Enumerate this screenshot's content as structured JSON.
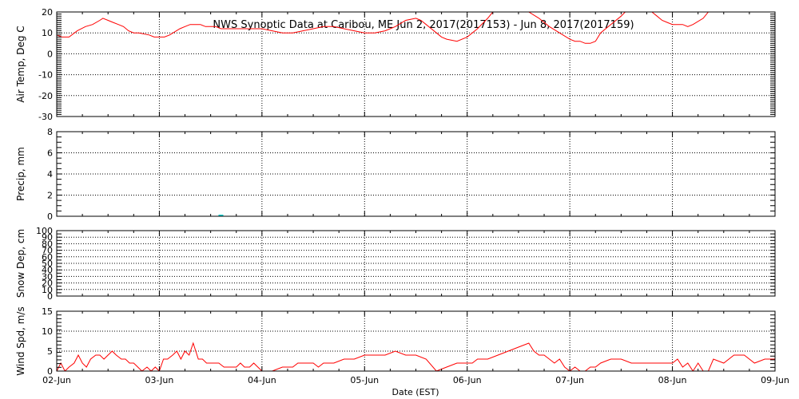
{
  "chart_data": {
    "title": "NWS Synoptic Data at Caribou, ME   Jun  2, 2017(2017153) - Jun  8, 2017(2017159)",
    "xlabel": "Date (EST)",
    "x_ticks": [
      "02-Jun",
      "03-Jun",
      "04-Jun",
      "05-Jun",
      "06-Jun",
      "07-Jun",
      "08-Jun",
      "09-Jun"
    ],
    "x_range_days": [
      0,
      7
    ],
    "colors": {
      "temp": "#ff0000",
      "precip": "#00cccc",
      "snow": "#ff0000",
      "wind": "#ff0000",
      "grid": "#000000"
    },
    "panels": [
      {
        "name": "air-temp",
        "type": "line",
        "ylabel": "Air Temp, Deg C",
        "ylim": [
          -30,
          20
        ],
        "yticks": [
          -30,
          -20,
          -10,
          0,
          10,
          20
        ],
        "ytick_labels": [
          "-30",
          "-20",
          "-10",
          "0",
          "10",
          "20"
        ],
        "grid": true,
        "series": [
          {
            "x": [
              0,
              0.05,
              0.12,
              0.2,
              0.28,
              0.35,
              0.42,
              0.45,
              0.5,
              0.55,
              0.6,
              0.65,
              0.7,
              0.75,
              0.8,
              0.9,
              0.95,
              1.0,
              1.05,
              1.1,
              1.2,
              1.25,
              1.3,
              1.35,
              1.4,
              1.45,
              1.5,
              1.55,
              1.6,
              1.65,
              1.7,
              1.8,
              1.9,
              2.0,
              2.1,
              2.2,
              2.3,
              2.4,
              2.5,
              2.6,
              2.7,
              2.8,
              2.9,
              3.0,
              3.1,
              3.2,
              3.3,
              3.4,
              3.5,
              3.55,
              3.6,
              3.65,
              3.7,
              3.75,
              3.8,
              3.9,
              4.0,
              4.1,
              4.2,
              4.25,
              4.3,
              4.4,
              4.5,
              4.6,
              4.7,
              4.8,
              4.9,
              5.0,
              5.05,
              5.1,
              5.15,
              5.2,
              5.25,
              5.3,
              5.4,
              5.5,
              5.6,
              5.7,
              5.8,
              5.85,
              5.9,
              5.95,
              6.0,
              6.1,
              6.15,
              6.2,
              6.3,
              6.35,
              6.4,
              6.45,
              6.5
            ],
            "y": [
              9,
              8,
              8,
              11,
              13,
              14,
              16,
              17,
              16,
              15,
              14,
              13,
              11,
              10,
              10,
              9,
              8,
              8,
              8,
              9,
              12,
              13,
              14,
              14,
              14,
              13,
              13,
              13,
              12,
              12,
              12,
              12,
              12,
              12,
              11,
              10,
              10,
              11,
              12,
              13,
              13,
              12,
              11,
              10,
              10,
              11,
              13,
              16,
              17,
              16,
              14,
              12,
              10,
              8,
              7,
              6,
              8,
              12,
              17,
              20,
              22,
              23,
              22,
              20,
              17,
              13,
              10,
              7,
              6,
              6,
              5,
              5,
              6,
              10,
              14,
              18,
              23,
              22,
              20,
              18,
              16,
              15,
              14,
              14,
              13,
              14,
              17,
              20,
              24,
              28,
              30
            ]
          }
        ]
      },
      {
        "name": "precip",
        "type": "bar",
        "ylabel": "Precip, mm",
        "ylim": [
          0,
          8
        ],
        "yticks": [
          0,
          2,
          4,
          6,
          8
        ],
        "ytick_labels": [
          "0",
          "2",
          "4",
          "6",
          "8"
        ],
        "grid": true,
        "series": [
          {
            "x": [
              1.6
            ],
            "y": [
              0.1
            ]
          }
        ]
      },
      {
        "name": "snow-depth",
        "type": "line",
        "ylabel": "Snow Dep, cm",
        "ylim": [
          0,
          100
        ],
        "yticks": [
          0,
          10,
          20,
          30,
          40,
          50,
          60,
          70,
          80,
          90,
          100
        ],
        "ytick_labels": [
          "0",
          "10",
          "20",
          "30",
          "40",
          "50",
          "60",
          "70",
          "80",
          "90",
          "100"
        ],
        "grid": true,
        "series": []
      },
      {
        "name": "wind-speed",
        "type": "line",
        "ylabel": "Wind Spd, m/s",
        "ylim": [
          0,
          15
        ],
        "yticks": [
          0,
          5,
          10,
          15
        ],
        "ytick_labels": [
          "0",
          "5",
          "10",
          "15"
        ],
        "grid": true,
        "series": [
          {
            "x": [
              0,
              0.04,
              0.08,
              0.12,
              0.17,
              0.21,
              0.25,
              0.29,
              0.33,
              0.38,
              0.42,
              0.46,
              0.5,
              0.54,
              0.58,
              0.63,
              0.67,
              0.71,
              0.75,
              0.79,
              0.83,
              0.88,
              0.92,
              0.96,
              1.0,
              1.04,
              1.08,
              1.13,
              1.17,
              1.21,
              1.25,
              1.29,
              1.33,
              1.38,
              1.42,
              1.46,
              1.5,
              1.54,
              1.58,
              1.63,
              1.67,
              1.71,
              1.75,
              1.79,
              1.83,
              1.88,
              1.92,
              1.96,
              2.0,
              2.1,
              2.2,
              2.25,
              2.3,
              2.35,
              2.4,
              2.45,
              2.5,
              2.55,
              2.6,
              2.65,
              2.7,
              2.8,
              2.9,
              3.0,
              3.1,
              3.2,
              3.3,
              3.4,
              3.5,
              3.6,
              3.7,
              3.8,
              3.9,
              4.0,
              4.05,
              4.1,
              4.2,
              4.3,
              4.4,
              4.5,
              4.6,
              4.65,
              4.7,
              4.75,
              4.8,
              4.85,
              4.9,
              4.95,
              5.0,
              5.05,
              5.1,
              5.15,
              5.2,
              5.25,
              5.3,
              5.4,
              5.5,
              5.6,
              5.7,
              5.8,
              5.9,
              6.0,
              6.05,
              6.1,
              6.15,
              6.2,
              6.25,
              6.3,
              6.35,
              6.4,
              6.5,
              6.6,
              6.7,
              6.8,
              6.9,
              7.0
            ],
            "y": [
              0,
              2,
              0,
              1,
              2,
              4,
              2,
              1,
              3,
              4,
              4,
              3,
              4,
              5,
              4,
              3,
              3,
              2,
              2,
              1,
              0,
              1,
              0,
              1,
              0,
              3,
              3,
              4,
              5,
              3,
              5,
              4,
              7,
              3,
              3,
              2,
              2,
              2,
              2,
              1,
              1,
              1,
              1,
              2,
              1,
              1,
              2,
              1,
              0,
              0,
              1,
              1,
              1,
              2,
              2,
              2,
              2,
              1,
              2,
              2,
              2,
              3,
              3,
              4,
              4,
              4,
              5,
              4,
              4,
              3,
              0,
              1,
              2,
              2,
              2,
              3,
              3,
              4,
              5,
              6,
              7,
              5,
              4,
              4,
              3,
              2,
              3,
              1,
              0,
              1,
              0,
              0,
              1,
              1,
              2,
              3,
              3,
              2,
              2,
              2,
              2,
              2,
              3,
              1,
              2,
              0,
              2,
              0,
              0,
              3,
              2,
              4,
              4,
              2,
              3,
              3
            ]
          }
        ]
      }
    ]
  }
}
